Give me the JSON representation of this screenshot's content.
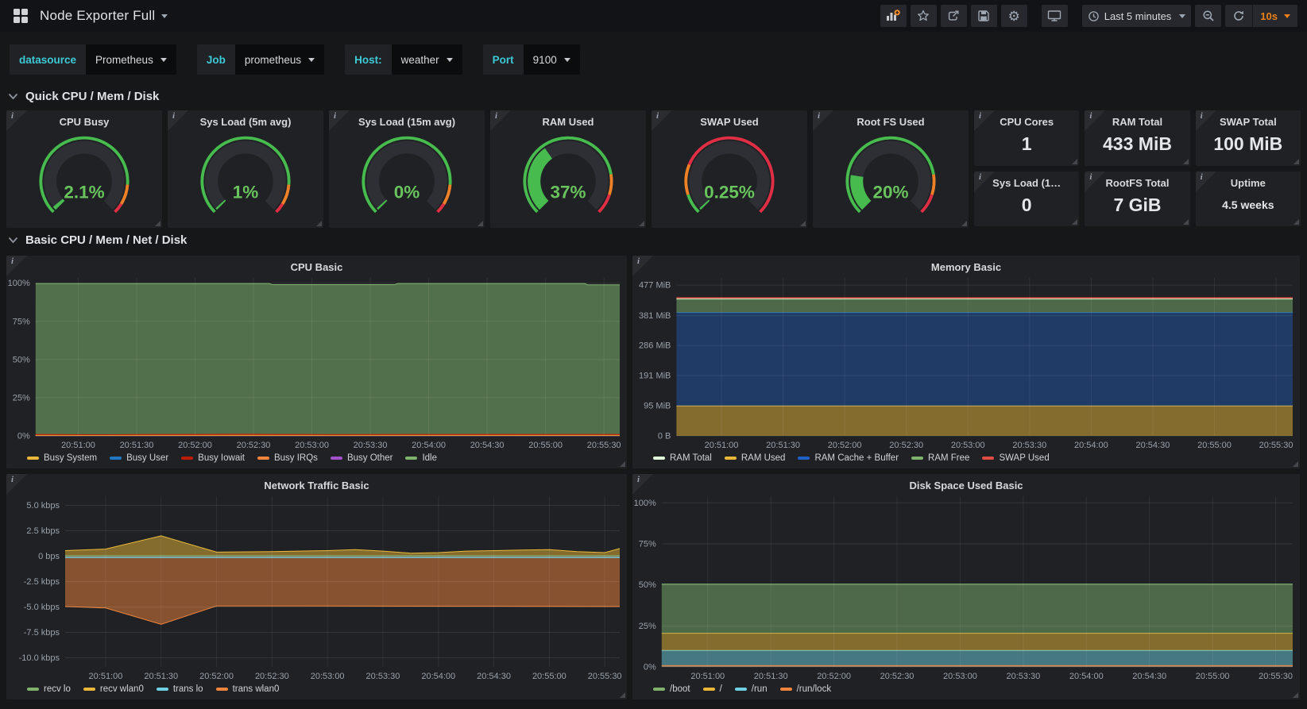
{
  "nav": {
    "title": "Node Exporter Full",
    "time_range": "Last 5 minutes",
    "refresh_interval": "10s"
  },
  "variables": [
    {
      "label": "datasource",
      "value": "Prometheus"
    },
    {
      "label": "Job",
      "value": "prometheus"
    },
    {
      "label": "Host:",
      "value": "weather"
    },
    {
      "label": "Port",
      "value": "9100"
    }
  ],
  "sections": [
    {
      "title": "Quick CPU / Mem / Disk"
    },
    {
      "title": "Basic CPU / Mem / Net / Disk"
    }
  ],
  "gauges": [
    {
      "title": "CPU Busy",
      "value_label": "2.1%",
      "fraction": 0.021,
      "thresholds": [
        {
          "upto": 0.85,
          "color": "#48bb4f"
        },
        {
          "upto": 0.95,
          "color": "#ED8128"
        },
        {
          "upto": 1,
          "color": "#E02F44"
        }
      ]
    },
    {
      "title": "Sys Load (5m avg)",
      "value_label": "1%",
      "fraction": 0.01,
      "thresholds": [
        {
          "upto": 0.85,
          "color": "#48bb4f"
        },
        {
          "upto": 0.95,
          "color": "#ED8128"
        },
        {
          "upto": 1,
          "color": "#E02F44"
        }
      ]
    },
    {
      "title": "Sys Load (15m avg)",
      "value_label": "0%",
      "fraction": 0.004,
      "thresholds": [
        {
          "upto": 0.85,
          "color": "#48bb4f"
        },
        {
          "upto": 0.95,
          "color": "#ED8128"
        },
        {
          "upto": 1,
          "color": "#E02F44"
        }
      ]
    },
    {
      "title": "RAM Used",
      "value_label": "37%",
      "fraction": 0.37,
      "thresholds": [
        {
          "upto": 0.8,
          "color": "#48bb4f"
        },
        {
          "upto": 0.9,
          "color": "#ED8128"
        },
        {
          "upto": 1,
          "color": "#E02F44"
        }
      ]
    },
    {
      "title": "SWAP Used",
      "value_label": "0.25%",
      "fraction": 0.0025,
      "thresholds": [
        {
          "upto": 0.1,
          "color": "#48bb4f"
        },
        {
          "upto": 0.25,
          "color": "#ED8128"
        },
        {
          "upto": 1,
          "color": "#E02F44"
        }
      ]
    },
    {
      "title": "Root FS Used",
      "value_label": "20%",
      "fraction": 0.2,
      "thresholds": [
        {
          "upto": 0.8,
          "color": "#48bb4f"
        },
        {
          "upto": 0.9,
          "color": "#ED8128"
        },
        {
          "upto": 1,
          "color": "#E02F44"
        }
      ]
    }
  ],
  "stats": [
    {
      "title": "CPU Cores",
      "value": "1",
      "small": false
    },
    {
      "title": "RAM Total",
      "value": "433 MiB",
      "small": false
    },
    {
      "title": "SWAP Total",
      "value": "100 MiB",
      "small": false
    },
    {
      "title": "Sys Load (1…",
      "value": "0",
      "small": false
    },
    {
      "title": "RootFS Total",
      "value": "7 GiB",
      "small": false
    },
    {
      "title": "Uptime",
      "value": "4.5 weeks",
      "small": true
    }
  ],
  "chart_data": [
    {
      "id": "cpu_basic",
      "type": "area",
      "title": "CPU Basic",
      "xlabel": "",
      "ylabel": "",
      "ylim": [
        0,
        103.5
      ],
      "grid": true,
      "legend_position": "bottom",
      "yticks": [
        {
          "v": 0,
          "label": "0%"
        },
        {
          "v": 25,
          "label": "25%"
        },
        {
          "v": 50,
          "label": "50%"
        },
        {
          "v": 75,
          "label": "75%"
        },
        {
          "v": 100,
          "label": "100%"
        }
      ],
      "xticks": {
        "start": 0.073,
        "step": 0.1,
        "labels": [
          "20:51:00",
          "20:51:30",
          "20:52:00",
          "20:52:30",
          "20:53:00",
          "20:53:30",
          "20:54:00",
          "20:54:30",
          "20:55:00",
          "20:55:30"
        ]
      },
      "series": [
        {
          "name": "Idle",
          "color": "#7EB26D",
          "x": [
            0,
            0.4,
            0.405,
            0.615,
            0.62,
            0.94,
            0.945,
            1
          ],
          "y": [
            99.8,
            99.8,
            99.1,
            99.1,
            99.8,
            99.8,
            99.0,
            99.0
          ],
          "fill_to": 0,
          "alpha": 0.55,
          "lw": 1
        },
        {
          "name": "Busy Other",
          "color": "#A352CC",
          "x": [
            0,
            1
          ],
          "y": [
            0.12,
            0.12
          ],
          "fill_to": 0,
          "alpha": 0.6,
          "lw": 1
        },
        {
          "name": "Busy User",
          "color": "#1F78C1",
          "x": [
            0,
            0.25,
            0.5,
            0.75,
            1
          ],
          "y": [
            0.45,
            0.5,
            0.42,
            0.48,
            0.45
          ],
          "fill_to": 0,
          "alpha": 0.6,
          "lw": 1
        },
        {
          "name": "Busy IRQs",
          "color": "#EF843C",
          "x": [
            0,
            1
          ],
          "y": [
            0.6,
            0.6
          ],
          "fill_to": 0,
          "alpha": 0.55,
          "lw": 1
        },
        {
          "name": "Busy System",
          "color": "#EAB839",
          "x": [
            0,
            1
          ],
          "y": [
            0.28,
            0.28
          ],
          "fill_to": 0,
          "alpha": 0.8,
          "lw": 1
        },
        {
          "name": "Busy Iowait",
          "color": "#BF1B00",
          "x": [
            0,
            0.1,
            0.2,
            0.35,
            0.5,
            0.65,
            0.8,
            0.9,
            1
          ],
          "y": [
            0.95,
            0.8,
            0.9,
            1.05,
            0.85,
            0.95,
            1.0,
            0.9,
            0.95
          ],
          "fill_to": 0.3,
          "alpha": 0.5,
          "lw": 1
        }
      ],
      "legend": [
        {
          "label": "Busy System",
          "color": "#EAB839"
        },
        {
          "label": "Busy User",
          "color": "#1F78C1"
        },
        {
          "label": "Busy Iowait",
          "color": "#BF1B00"
        },
        {
          "label": "Busy IRQs",
          "color": "#EF843C"
        },
        {
          "label": "Busy Other",
          "color": "#A352CC"
        },
        {
          "label": "Idle",
          "color": "#7EB26D"
        }
      ]
    },
    {
      "id": "memory_basic",
      "type": "area",
      "title": "Memory Basic",
      "xlabel": "",
      "ylabel": "",
      "ylim": [
        0,
        500
      ],
      "grid": true,
      "legend_position": "bottom",
      "yticks": [
        {
          "v": 0,
          "label": "0 B"
        },
        {
          "v": 95,
          "label": "95 MiB"
        },
        {
          "v": 191,
          "label": "191 MiB"
        },
        {
          "v": 286,
          "label": "286 MiB"
        },
        {
          "v": 381,
          "label": "381 MiB"
        },
        {
          "v": 477,
          "label": "477 MiB"
        }
      ],
      "xticks": {
        "start": 0.073,
        "step": 0.1,
        "labels": [
          "20:51:00",
          "20:51:30",
          "20:52:00",
          "20:52:30",
          "20:53:00",
          "20:53:30",
          "20:54:00",
          "20:54:30",
          "20:55:00",
          "20:55:30"
        ]
      },
      "series": [
        {
          "name": "RAM Used",
          "color": "#EAB839",
          "x": [
            0,
            1
          ],
          "y": [
            95,
            95
          ],
          "fill_to": 0,
          "alpha": 0.5,
          "lw": 1
        },
        {
          "name": "RAM Cache + Buffer",
          "color": "#1F60C4",
          "x": [
            0,
            1
          ],
          "y": [
            390,
            390
          ],
          "fill_to": 95,
          "alpha": 0.42,
          "lw": 1
        },
        {
          "name": "RAM Free",
          "color": "#7EB26D",
          "x": [
            0,
            1
          ],
          "y": [
            433,
            433
          ],
          "fill_to": 390,
          "alpha": 0.5,
          "lw": 1
        },
        {
          "name": "RAM Total",
          "color": "#E0F9D7",
          "x": [
            0,
            1
          ],
          "y": [
            434,
            434
          ],
          "fill_to": null,
          "alpha": 0,
          "lw": 1
        },
        {
          "name": "SWAP Used",
          "color": "#E24D42",
          "x": [
            0,
            1
          ],
          "y": [
            437,
            437
          ],
          "fill_to": null,
          "alpha": 0,
          "lw": 1.5
        }
      ],
      "legend": [
        {
          "label": "RAM Total",
          "color": "#E0F9D7"
        },
        {
          "label": "RAM Used",
          "color": "#EAB839"
        },
        {
          "label": "RAM Cache + Buffer",
          "color": "#1F60C4"
        },
        {
          "label": "RAM Free",
          "color": "#7EB26D"
        },
        {
          "label": "SWAP Used",
          "color": "#E24D42"
        }
      ]
    },
    {
      "id": "network_traffic_basic",
      "type": "area",
      "title": "Network Traffic Basic",
      "xlabel": "",
      "ylabel": "",
      "ylim": [
        -10.9,
        5.9
      ],
      "grid": true,
      "legend_position": "bottom",
      "yticks": [
        {
          "v": 5,
          "label": "5.0 kbps"
        },
        {
          "v": 2.5,
          "label": "2.5 kbps"
        },
        {
          "v": 0,
          "label": "0 bps"
        },
        {
          "v": -2.5,
          "label": "-2.5 kbps"
        },
        {
          "v": -5,
          "label": "-5.0 kbps"
        },
        {
          "v": -7.5,
          "label": "-7.5 kbps"
        },
        {
          "v": -10,
          "label": "-10.0 kbps"
        }
      ],
      "xticks": {
        "start": 0.073,
        "step": 0.1,
        "labels": [
          "20:51:00",
          "20:51:30",
          "20:52:00",
          "20:52:30",
          "20:53:00",
          "20:53:30",
          "20:54:00",
          "20:54:30",
          "20:55:00",
          "20:55:30"
        ]
      },
      "series": [
        {
          "name": "recv wlan0",
          "color": "#EAB839",
          "x": [
            0,
            0.073,
            0.173,
            0.273,
            0.373,
            0.473,
            0.523,
            0.573,
            0.623,
            0.673,
            0.723,
            0.773,
            0.823,
            0.873,
            0.923,
            0.973,
            1
          ],
          "y": [
            0.55,
            0.7,
            2.0,
            0.4,
            0.45,
            0.55,
            0.65,
            0.5,
            0.3,
            0.35,
            0.5,
            0.55,
            0.6,
            0.65,
            0.45,
            0.35,
            0.75
          ],
          "fill_to": 0,
          "alpha": 0.5,
          "lw": 1
        },
        {
          "name": "trans wlan0",
          "color": "#EF843C",
          "x": [
            0,
            0.073,
            0.173,
            0.273,
            0.373,
            1
          ],
          "y": [
            -4.95,
            -5.1,
            -6.7,
            -4.9,
            -4.9,
            -4.95
          ],
          "fill_to": 0,
          "alpha": 0.5,
          "lw": 1
        },
        {
          "name": "recv lo",
          "color": "#7EB26D",
          "x": [
            0,
            1
          ],
          "y": [
            0.06,
            0.06
          ],
          "fill_to": null,
          "alpha": 0,
          "lw": 1
        },
        {
          "name": "trans lo",
          "color": "#6ED0E0",
          "x": [
            0,
            1
          ],
          "y": [
            -0.12,
            -0.12
          ],
          "fill_to": null,
          "alpha": 0,
          "lw": 1.5
        }
      ],
      "legend": [
        {
          "label": "recv lo",
          "color": "#7EB26D"
        },
        {
          "label": "recv wlan0",
          "color": "#EAB839"
        },
        {
          "label": "trans lo",
          "color": "#6ED0E0"
        },
        {
          "label": "trans wlan0",
          "color": "#EF843C"
        }
      ]
    },
    {
      "id": "disk_space_used_basic",
      "type": "area",
      "title": "Disk Space Used Basic",
      "xlabel": "",
      "ylabel": "",
      "ylim": [
        0,
        104
      ],
      "grid": true,
      "legend_position": "bottom",
      "yticks": [
        {
          "v": 0,
          "label": "0%"
        },
        {
          "v": 25,
          "label": "25%"
        },
        {
          "v": 50,
          "label": "50%"
        },
        {
          "v": 75,
          "label": "75%"
        },
        {
          "v": 100,
          "label": "100%"
        }
      ],
      "xticks": {
        "start": 0.073,
        "step": 0.1,
        "labels": [
          "20:51:00",
          "20:51:30",
          "20:52:00",
          "20:52:30",
          "20:53:00",
          "20:53:30",
          "20:54:00",
          "20:54:30",
          "20:55:00",
          "20:55:30"
        ]
      },
      "series": [
        {
          "name": "/run",
          "color": "#6ED0E0",
          "x": [
            0,
            1
          ],
          "y": [
            10,
            10
          ],
          "fill_to": 0,
          "alpha": 0.5,
          "lw": 1
        },
        {
          "name": "/",
          "color": "#EAB839",
          "x": [
            0,
            1
          ],
          "y": [
            20.5,
            20.5
          ],
          "fill_to": 10,
          "alpha": 0.5,
          "lw": 1
        },
        {
          "name": "/boot",
          "color": "#7EB26D",
          "x": [
            0,
            1
          ],
          "y": [
            50.5,
            50.5
          ],
          "fill_to": 20.5,
          "alpha": 0.5,
          "lw": 1
        },
        {
          "name": "/run/lock",
          "color": "#EF843C",
          "x": [
            0,
            1
          ],
          "y": [
            0.7,
            0.7
          ],
          "fill_to": null,
          "alpha": 0,
          "lw": 1.5
        }
      ],
      "legend": [
        {
          "label": "/boot",
          "color": "#7EB26D"
        },
        {
          "label": "/",
          "color": "#EAB839"
        },
        {
          "label": "/run",
          "color": "#6ED0E0"
        },
        {
          "label": "/run/lock",
          "color": "#EF843C"
        }
      ]
    }
  ],
  "colors": {
    "accent_cyan": "#3dc9d6",
    "accent_orange": "#eb8019",
    "gauge_value_green": "#6ac45e",
    "gauge_band_bg": "#2d2f34",
    "panel_bg": "#1f2124",
    "page_bg": "#161719"
  }
}
